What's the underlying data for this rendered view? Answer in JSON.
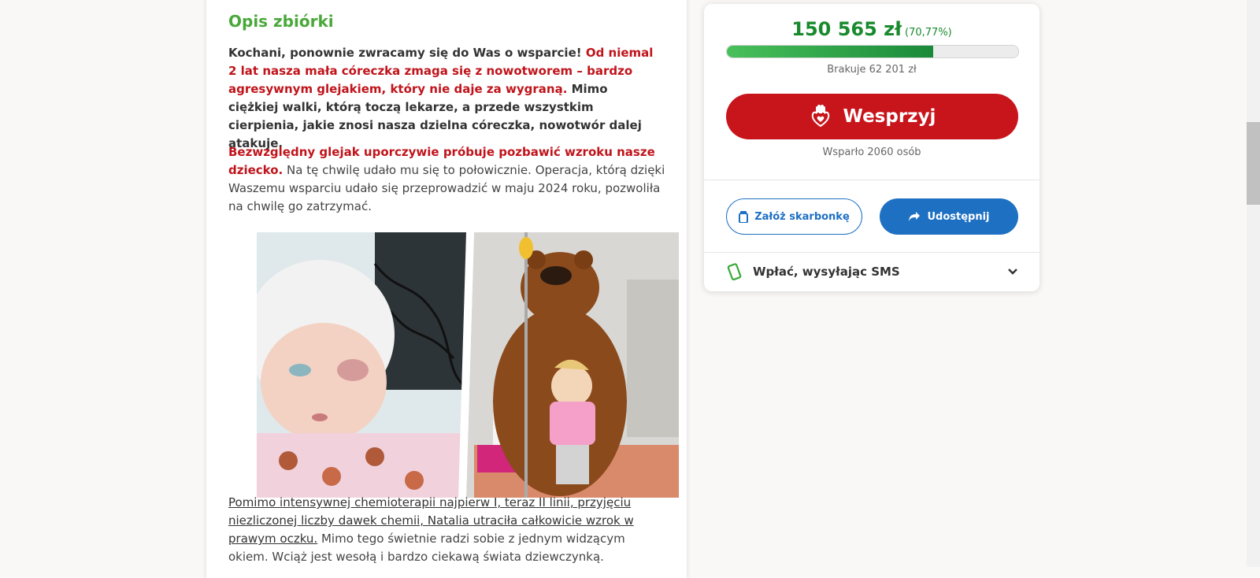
{
  "description": {
    "title": "Opis zbiórki",
    "p1_normal": "Kochani, ponownie zwracamy się do Was o wsparcie! ",
    "p1_red": "Od niemal 2 lat nasza mała córeczka zmaga się z nowotworem – bardzo agresywnym glejakiem, który nie daje za wygraną.",
    "p1_rest": " Mimo ciężkiej walki, którą toczą lekarze, a przede wszystkim cierpienia, jakie znosi nasza dzielna córeczka, nowotwór dalej atakuje.",
    "p2_red": "Bezwzględny glejak uporczywie próbuje pozbawić wzroku nasze dziecko.",
    "p2_rest": " Na tę chwilę udało mu się to połowicznie. Operacja, którą dzięki Waszemu wsparciu udało się przeprowadzić w maju 2024 roku, pozwoliła na chwilę go zatrzymać.",
    "p3_underlined": "Pomimo intensywnej chemioterapii najpierw I, teraz II linii, przyjęciu niezliczonej liczby dawek chemii, Natalia utraciła całkowicie wzrok w prawym oczku.",
    "p3_rest": " Mimo tego świetnie radzi sobie z jednym widzącym okiem. Wciąż jest wesołą i bardzo ciekawą świata dziewczynką."
  },
  "fundraiser": {
    "amount": "150 565 zł",
    "percent_label": "(70,77%)",
    "progress_fraction": 0.7077,
    "missing": "Brakuje 62 201 zł",
    "support_button": "Wesprzyj",
    "supporters": "Wsparło 2060 osób",
    "piggybank_button": "Załóż skarbonkę",
    "share_button": "Udostępnij",
    "sms_label": "Wpłać, wysyłając SMS"
  },
  "colors": {
    "accent_green": "#4aa83a",
    "amount_green": "#1a8a2e",
    "brand_red": "#c8141b",
    "link_blue": "#1e70c3"
  },
  "icons": {
    "support": "heart-hands-icon",
    "piggybank": "jar-icon",
    "share": "share-arrow-icon",
    "sms": "phone-icon",
    "expand": "chevron-down-icon"
  }
}
